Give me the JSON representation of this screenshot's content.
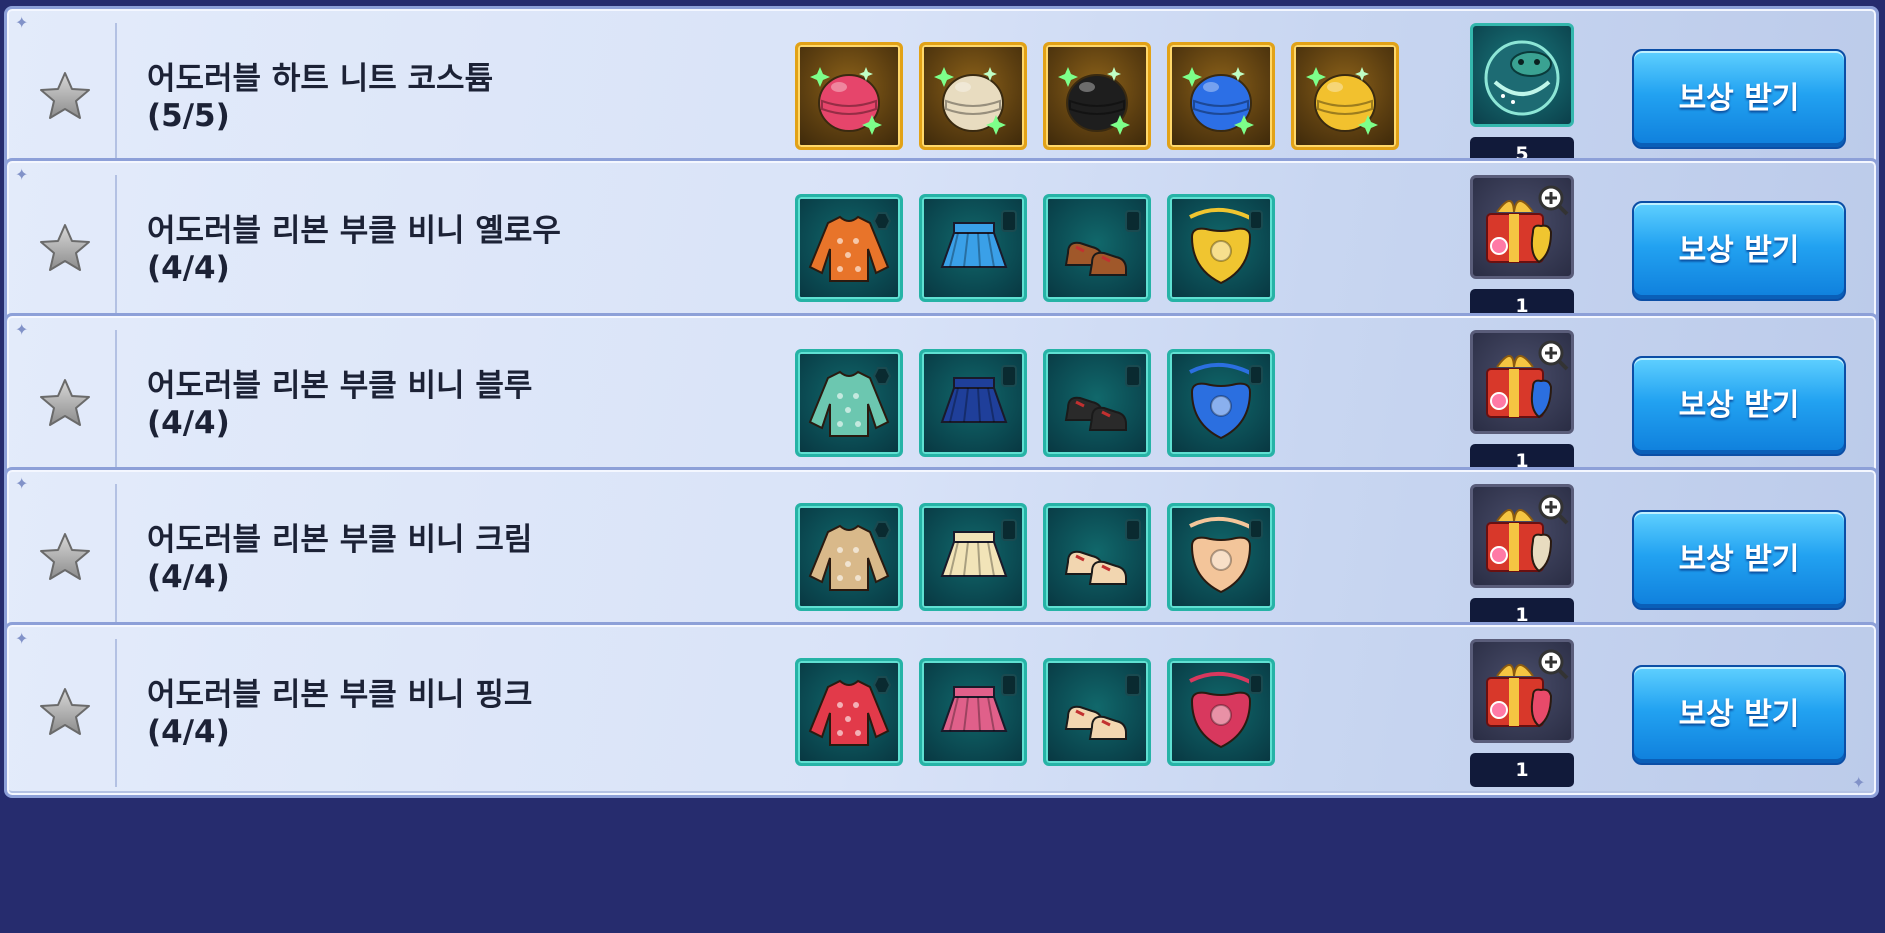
{
  "claim_button_label": "보상 받기",
  "rows": [
    {
      "title": "어도러블 하트 니트 코스튬",
      "progress": "(5/5)",
      "frame": "gold",
      "items": [
        {
          "icon": "hat-pink-icon",
          "color": "#e6456b"
        },
        {
          "icon": "hat-cream-icon",
          "color": "#e8dcc0"
        },
        {
          "icon": "hat-black-icon",
          "color": "#1e1e1e"
        },
        {
          "icon": "hat-blue-icon",
          "color": "#2c6fe6"
        },
        {
          "icon": "hat-yellow-icon",
          "color": "#f2c12e"
        }
      ],
      "reward": {
        "icon": "mount-orb-icon",
        "count": "5"
      }
    },
    {
      "title": "어도러블 리본 부클 비니 옐로우",
      "progress": "(4/4)",
      "frame": "teal",
      "items": [
        {
          "icon": "sweater-icon",
          "color": "#e8742a"
        },
        {
          "icon": "skirt-icon",
          "color": "#3aa0e8"
        },
        {
          "icon": "shoes-icon",
          "color": "#a0582a"
        },
        {
          "icon": "bag-icon",
          "color": "#f0c530"
        }
      ],
      "reward": {
        "icon": "gift-box-icon",
        "count": "1",
        "accent": "#f0c530"
      }
    },
    {
      "title": "어도러블 리본 부클 비니 블루",
      "progress": "(4/4)",
      "frame": "teal",
      "items": [
        {
          "icon": "sweater-icon",
          "color": "#6cc7b0"
        },
        {
          "icon": "skirt-icon",
          "color": "#1f3f9a"
        },
        {
          "icon": "shoes-icon",
          "color": "#2a2a2a"
        },
        {
          "icon": "bag-icon",
          "color": "#2b6fe0"
        }
      ],
      "reward": {
        "icon": "gift-box-icon",
        "count": "1",
        "accent": "#2b6fe0"
      }
    },
    {
      "title": "어도러블 리본 부클 비니 크림",
      "progress": "(4/4)",
      "frame": "teal",
      "items": [
        {
          "icon": "sweater-icon",
          "color": "#d9b98a"
        },
        {
          "icon": "skirt-icon",
          "color": "#f2e4b8"
        },
        {
          "icon": "shoes-icon",
          "color": "#f2d6b0"
        },
        {
          "icon": "bag-icon",
          "color": "#f3c59a"
        }
      ],
      "reward": {
        "icon": "gift-box-icon",
        "count": "1",
        "accent": "#e8dcc0"
      }
    },
    {
      "title": "어도러블 리본 부클 비니 핑크",
      "progress": "(4/4)",
      "frame": "teal",
      "items": [
        {
          "icon": "sweater-icon",
          "color": "#e23a4a"
        },
        {
          "icon": "skirt-icon",
          "color": "#e0608a"
        },
        {
          "icon": "shoes-icon",
          "color": "#f2d6b0"
        },
        {
          "icon": "bag-icon",
          "color": "#d8385e"
        }
      ],
      "reward": {
        "icon": "gift-box-icon",
        "count": "1",
        "accent": "#e84a6a"
      }
    }
  ]
}
